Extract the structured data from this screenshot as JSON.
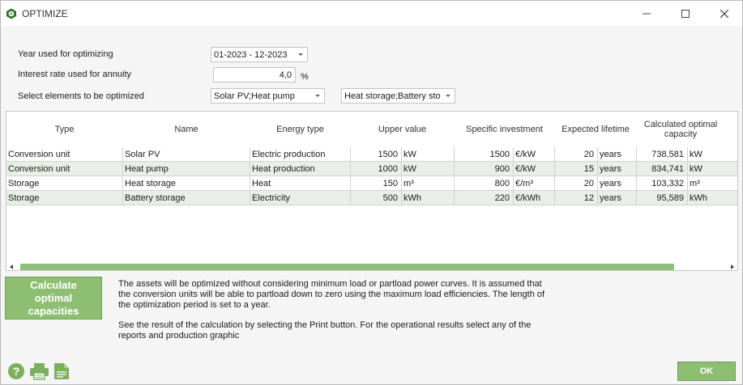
{
  "window": {
    "title": "OPTIMIZE",
    "icons": {
      "app": "app-logo-icon",
      "minimize": "minimize-icon",
      "maximize": "maximize-icon",
      "close": "close-icon"
    }
  },
  "form": {
    "year_label": "Year used for optimizing",
    "year_value": "01-2023 - 12-2023",
    "interest_label": "Interest rate used for annuity",
    "interest_value": "4,0",
    "interest_unit": "%",
    "elements_label": "Select elements to be optimized",
    "elements_value_1": "Solar PV;Heat pump",
    "elements_value_2": "Heat storage;Battery sto"
  },
  "table": {
    "columns": {
      "type": "Type",
      "name": "Name",
      "energy_type": "Energy type",
      "upper_value": "Upper value",
      "specific_investment": "Specific investment",
      "expected_lifetime": "Expected lifetime",
      "optimal_capacity": "Calculated optimal capacity"
    },
    "rows": [
      {
        "type": "Conversion unit",
        "name": "Solar PV",
        "energy_type": "Electric production",
        "upper_value": "1500",
        "upper_unit": "kW",
        "investment": "1500",
        "investment_unit": "€/kW",
        "lifetime": "20",
        "lifetime_unit": "years",
        "capacity": "738,581",
        "capacity_unit": "kW"
      },
      {
        "type": "Conversion unit",
        "name": "Heat pump",
        "energy_type": "Heat production",
        "upper_value": "1000",
        "upper_unit": "kW",
        "investment": "900",
        "investment_unit": "€/kW",
        "lifetime": "15",
        "lifetime_unit": "years",
        "capacity": "834,741",
        "capacity_unit": "kW"
      },
      {
        "type": "Storage",
        "name": "Heat storage",
        "energy_type": "Heat",
        "upper_value": "150",
        "upper_unit": "m³",
        "investment": "800",
        "investment_unit": "€/m³",
        "lifetime": "20",
        "lifetime_unit": "years",
        "capacity": "103,332",
        "capacity_unit": "m³"
      },
      {
        "type": "Storage",
        "name": "Battery storage",
        "energy_type": "Electricity",
        "upper_value": "500",
        "upper_unit": "kWh",
        "investment": "220",
        "investment_unit": "€/kWh",
        "lifetime": "12",
        "lifetime_unit": "years",
        "capacity": "95,589",
        "capacity_unit": "kWh"
      }
    ]
  },
  "actions": {
    "calculate_label": "Calculate optimal capacities",
    "ok_label": "OK",
    "icons": {
      "help": "help-icon",
      "print": "print-icon",
      "export": "export-document-icon"
    }
  },
  "info": {
    "paragraph_1": "The assets will be optimized without considering minimum load or partload power curves. It is assumed that the conversion units will be able to partload down to zero using the maximum load efficiencies. The length of the optimization period is set to a year.",
    "paragraph_2": "See the result of the calculation by selecting the Print button. For the operational results select any of the reports and production graphic"
  },
  "colors": {
    "accent_green": "#8dbe72",
    "row_alt": "#e8efe6",
    "scroll_thumb": "#8fc07c"
  }
}
